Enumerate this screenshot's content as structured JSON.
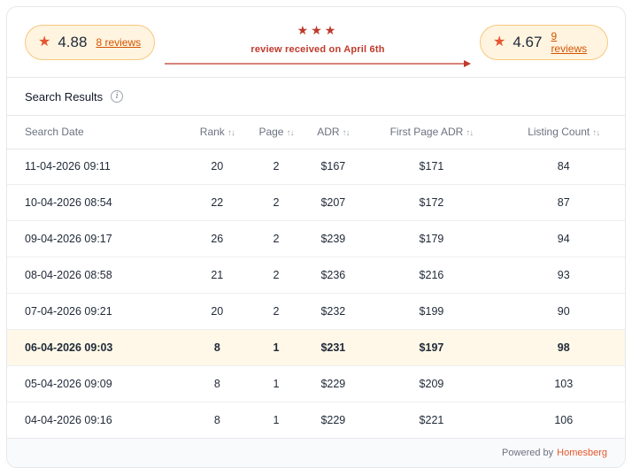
{
  "header": {
    "before": {
      "rating": "4.88",
      "reviews": "8 reviews"
    },
    "after": {
      "rating": "4.67",
      "reviews": "9 reviews"
    },
    "change_stars": "★★★",
    "change_note": "review received on April 6th",
    "accent_color": "#c0392b",
    "star_icon": "star-icon"
  },
  "section": {
    "title": "Search Results",
    "info_icon": "info-icon"
  },
  "table": {
    "columns": [
      "Search Date",
      "Rank",
      "Page",
      "ADR",
      "First Page ADR",
      "Listing Count"
    ],
    "sort_glyph": "↑↓",
    "rows": [
      [
        "11-04-2026 09:11",
        "20",
        "2",
        "$167",
        "$171",
        "84"
      ],
      [
        "10-04-2026 08:54",
        "22",
        "2",
        "$207",
        "$172",
        "87"
      ],
      [
        "09-04-2026 09:17",
        "26",
        "2",
        "$239",
        "$179",
        "94"
      ],
      [
        "08-04-2026 08:58",
        "21",
        "2",
        "$236",
        "$216",
        "93"
      ],
      [
        "07-04-2026 09:21",
        "20",
        "2",
        "$232",
        "$199",
        "90"
      ],
      [
        "06-04-2026 09:03",
        "8",
        "1",
        "$231",
        "$197",
        "98"
      ],
      [
        "05-04-2026 09:09",
        "8",
        "1",
        "$229",
        "$209",
        "103"
      ],
      [
        "04-04-2026 09:16",
        "8",
        "1",
        "$229",
        "$221",
        "106"
      ]
    ],
    "highlighted_row": 5,
    "highlight_color": "#fff8e8"
  },
  "footer": {
    "powered_by": "Powered by",
    "brand": "Homesberg",
    "brand_color": "#e4572e"
  }
}
